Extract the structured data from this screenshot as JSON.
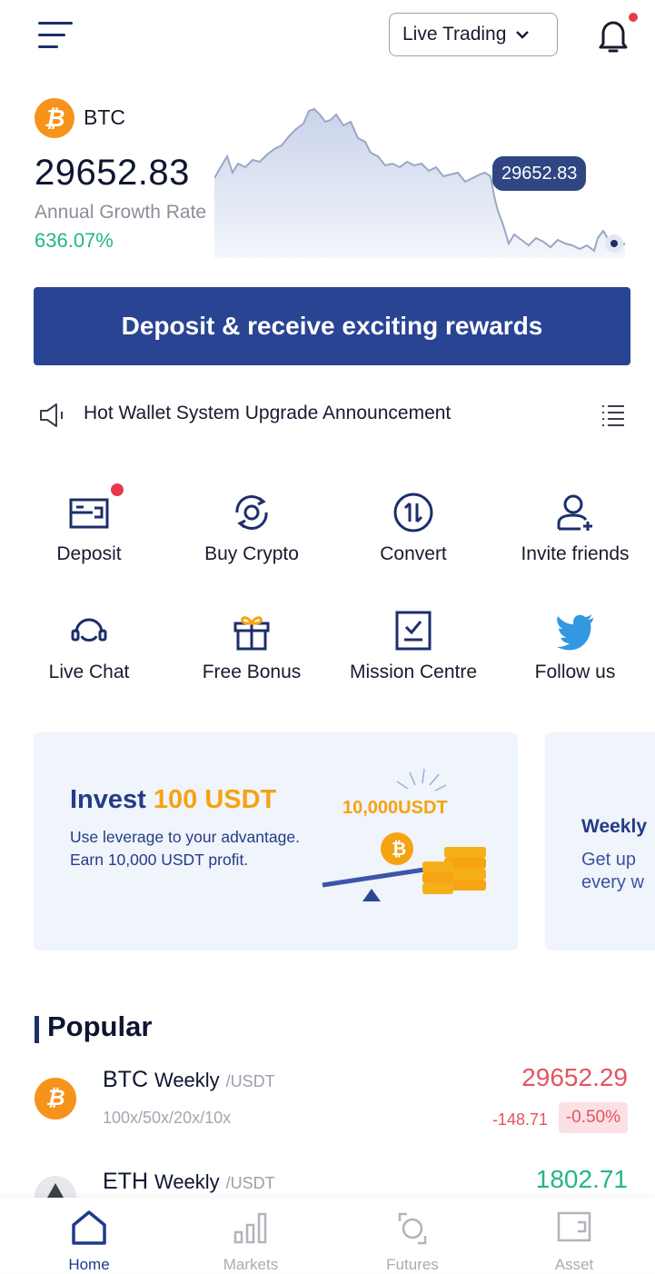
{
  "header": {
    "mode_label": "Live Trading",
    "notification_dot": true
  },
  "ticker": {
    "symbol": "BTC",
    "price": "29652.83",
    "rate_label": "Annual Growth Rate",
    "rate_value": "636.07%",
    "chart_tag": "29652.83"
  },
  "banner": {
    "label": "Deposit & receive exciting rewards"
  },
  "announcement": {
    "text": "Hot Wallet System Upgrade Announcement"
  },
  "shortcuts": [
    {
      "label": "Deposit",
      "icon": "deposit-icon"
    },
    {
      "label": "Buy Crypto",
      "icon": "buy-crypto-icon"
    },
    {
      "label": "Convert",
      "icon": "convert-icon"
    },
    {
      "label": "Invite friends",
      "icon": "invite-friends-icon"
    },
    {
      "label": "Live Chat",
      "icon": "headset-icon"
    },
    {
      "label": "Free Bonus",
      "icon": "gift-icon"
    },
    {
      "label": "Mission Centre",
      "icon": "checklist-icon"
    },
    {
      "label": "Follow us",
      "icon": "twitter-icon"
    }
  ],
  "promos": [
    {
      "title_prefix": "Invest",
      "title_highlight": "100 USDT",
      "line1": "Use leverage to your advantage.",
      "line2": "Earn 10,000 USDT profit.",
      "art_label": "10,000USDT"
    },
    {
      "title": "Weekly",
      "line1": "Get up",
      "line2": "every w"
    }
  ],
  "popular": {
    "title": "Popular",
    "rows": [
      {
        "symbol": "BTC",
        "period": "Weekly",
        "quote": "/USDT",
        "leverage": "100x/50x/20x/10x",
        "price": "29652.29",
        "change": "-148.71",
        "percent": "-0.50%",
        "direction": "down"
      },
      {
        "symbol": "ETH",
        "period": "Weekly",
        "quote": "/USDT",
        "price": "1802.71",
        "direction": "up"
      }
    ]
  },
  "nav": [
    {
      "label": "Home",
      "icon": "home-icon",
      "active": true
    },
    {
      "label": "Markets",
      "icon": "markets-icon",
      "active": false
    },
    {
      "label": "Futures",
      "icon": "futures-icon",
      "active": false
    },
    {
      "label": "Asset",
      "icon": "wallet-icon",
      "active": false
    }
  ],
  "colors": {
    "brand_blue": "#2a4494",
    "up_green": "#22b68a",
    "down_red": "#e25461",
    "accent_orange": "#f5a312"
  }
}
